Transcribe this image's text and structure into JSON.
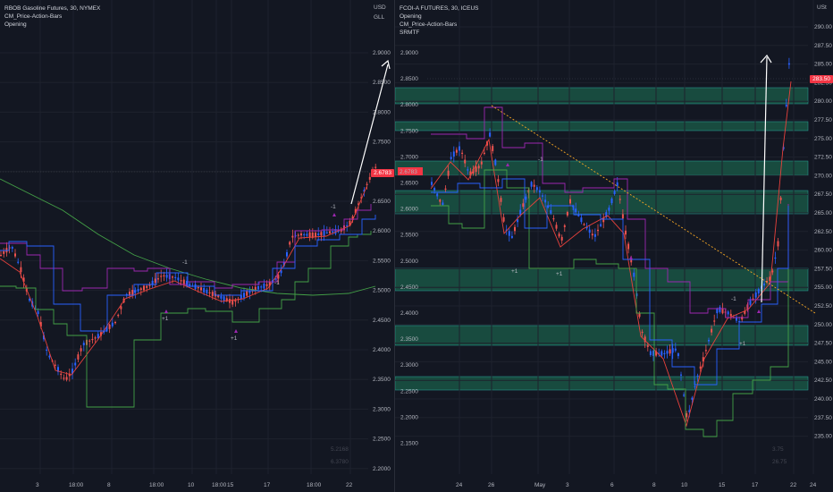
{
  "left": {
    "title": "RBOB Gasoline Futures, 30, NYMEX",
    "indicators": [
      "CM_Price-Action-Bars",
      "Opening"
    ],
    "currency": "USD",
    "unit": "GLL",
    "price_tag": "2.6783",
    "y_ticks": [
      "2.9000",
      "2.8500",
      "2.8000",
      "2.7500",
      "2.7000",
      "2.6500",
      "2.6000",
      "2.5500",
      "2.5000",
      "2.4500",
      "2.4000",
      "2.3500",
      "2.3000",
      "2.2500",
      "2.2000",
      "2.1500"
    ],
    "x_ticks": [
      "3",
      "18:00",
      "8",
      "18:00",
      "10",
      "18:00",
      "15",
      "17",
      "18:00",
      "22"
    ],
    "markers": [
      {
        "text": "-1",
        "color": "#d1d4dc"
      },
      {
        "text": "-1",
        "color": "#d1d4dc"
      },
      {
        "text": "-1",
        "color": "#d1d4dc"
      },
      {
        "text": "+1",
        "color": "#d1d4dc"
      },
      {
        "text": "+1",
        "color": "#d1d4dc"
      }
    ],
    "faded_values": [
      "5.2168",
      "6.3780"
    ]
  },
  "right": {
    "title": "FCOI-A FUTURES, 30, ICEUS",
    "indicators": [
      "Opening",
      "CM_Price-Action-Bars",
      "SRMTF"
    ],
    "unit": "USt",
    "price_tag": "283.50",
    "y_ticks": [
      "290.00",
      "287.50",
      "285.00",
      "282.50",
      "280.00",
      "277.50",
      "275.00",
      "272.50",
      "270.00",
      "267.50",
      "265.00",
      "262.50",
      "260.00",
      "257.50",
      "255.00",
      "252.50",
      "250.00",
      "247.50",
      "245.00",
      "242.50",
      "240.00",
      "237.50",
      "235.00"
    ],
    "x_ticks": [
      "24",
      "26",
      "May",
      "3",
      "6",
      "8",
      "10",
      "15",
      "17",
      "22",
      "24"
    ],
    "markers": [
      {
        "text": "-1",
        "color": "#d1d4dc"
      },
      {
        "text": "+1",
        "color": "#d1d4dc"
      },
      {
        "text": "+1",
        "color": "#d1d4dc"
      },
      {
        "text": "-1",
        "color": "#d1d4dc"
      },
      {
        "text": "+1",
        "color": "#d1d4dc"
      }
    ],
    "faded_values": [
      "3.75",
      "26.75"
    ]
  },
  "colors": {
    "up": "#2962ff",
    "down": "#ef5350",
    "ma_red": "#e8413c",
    "ma_purple": "#9c27b0",
    "ma_green": "#43a047",
    "zone": "#1b5e4a",
    "arrow": "#ffffff",
    "trend": "#f5a623",
    "price_tag_bg": "#f23645"
  }
}
